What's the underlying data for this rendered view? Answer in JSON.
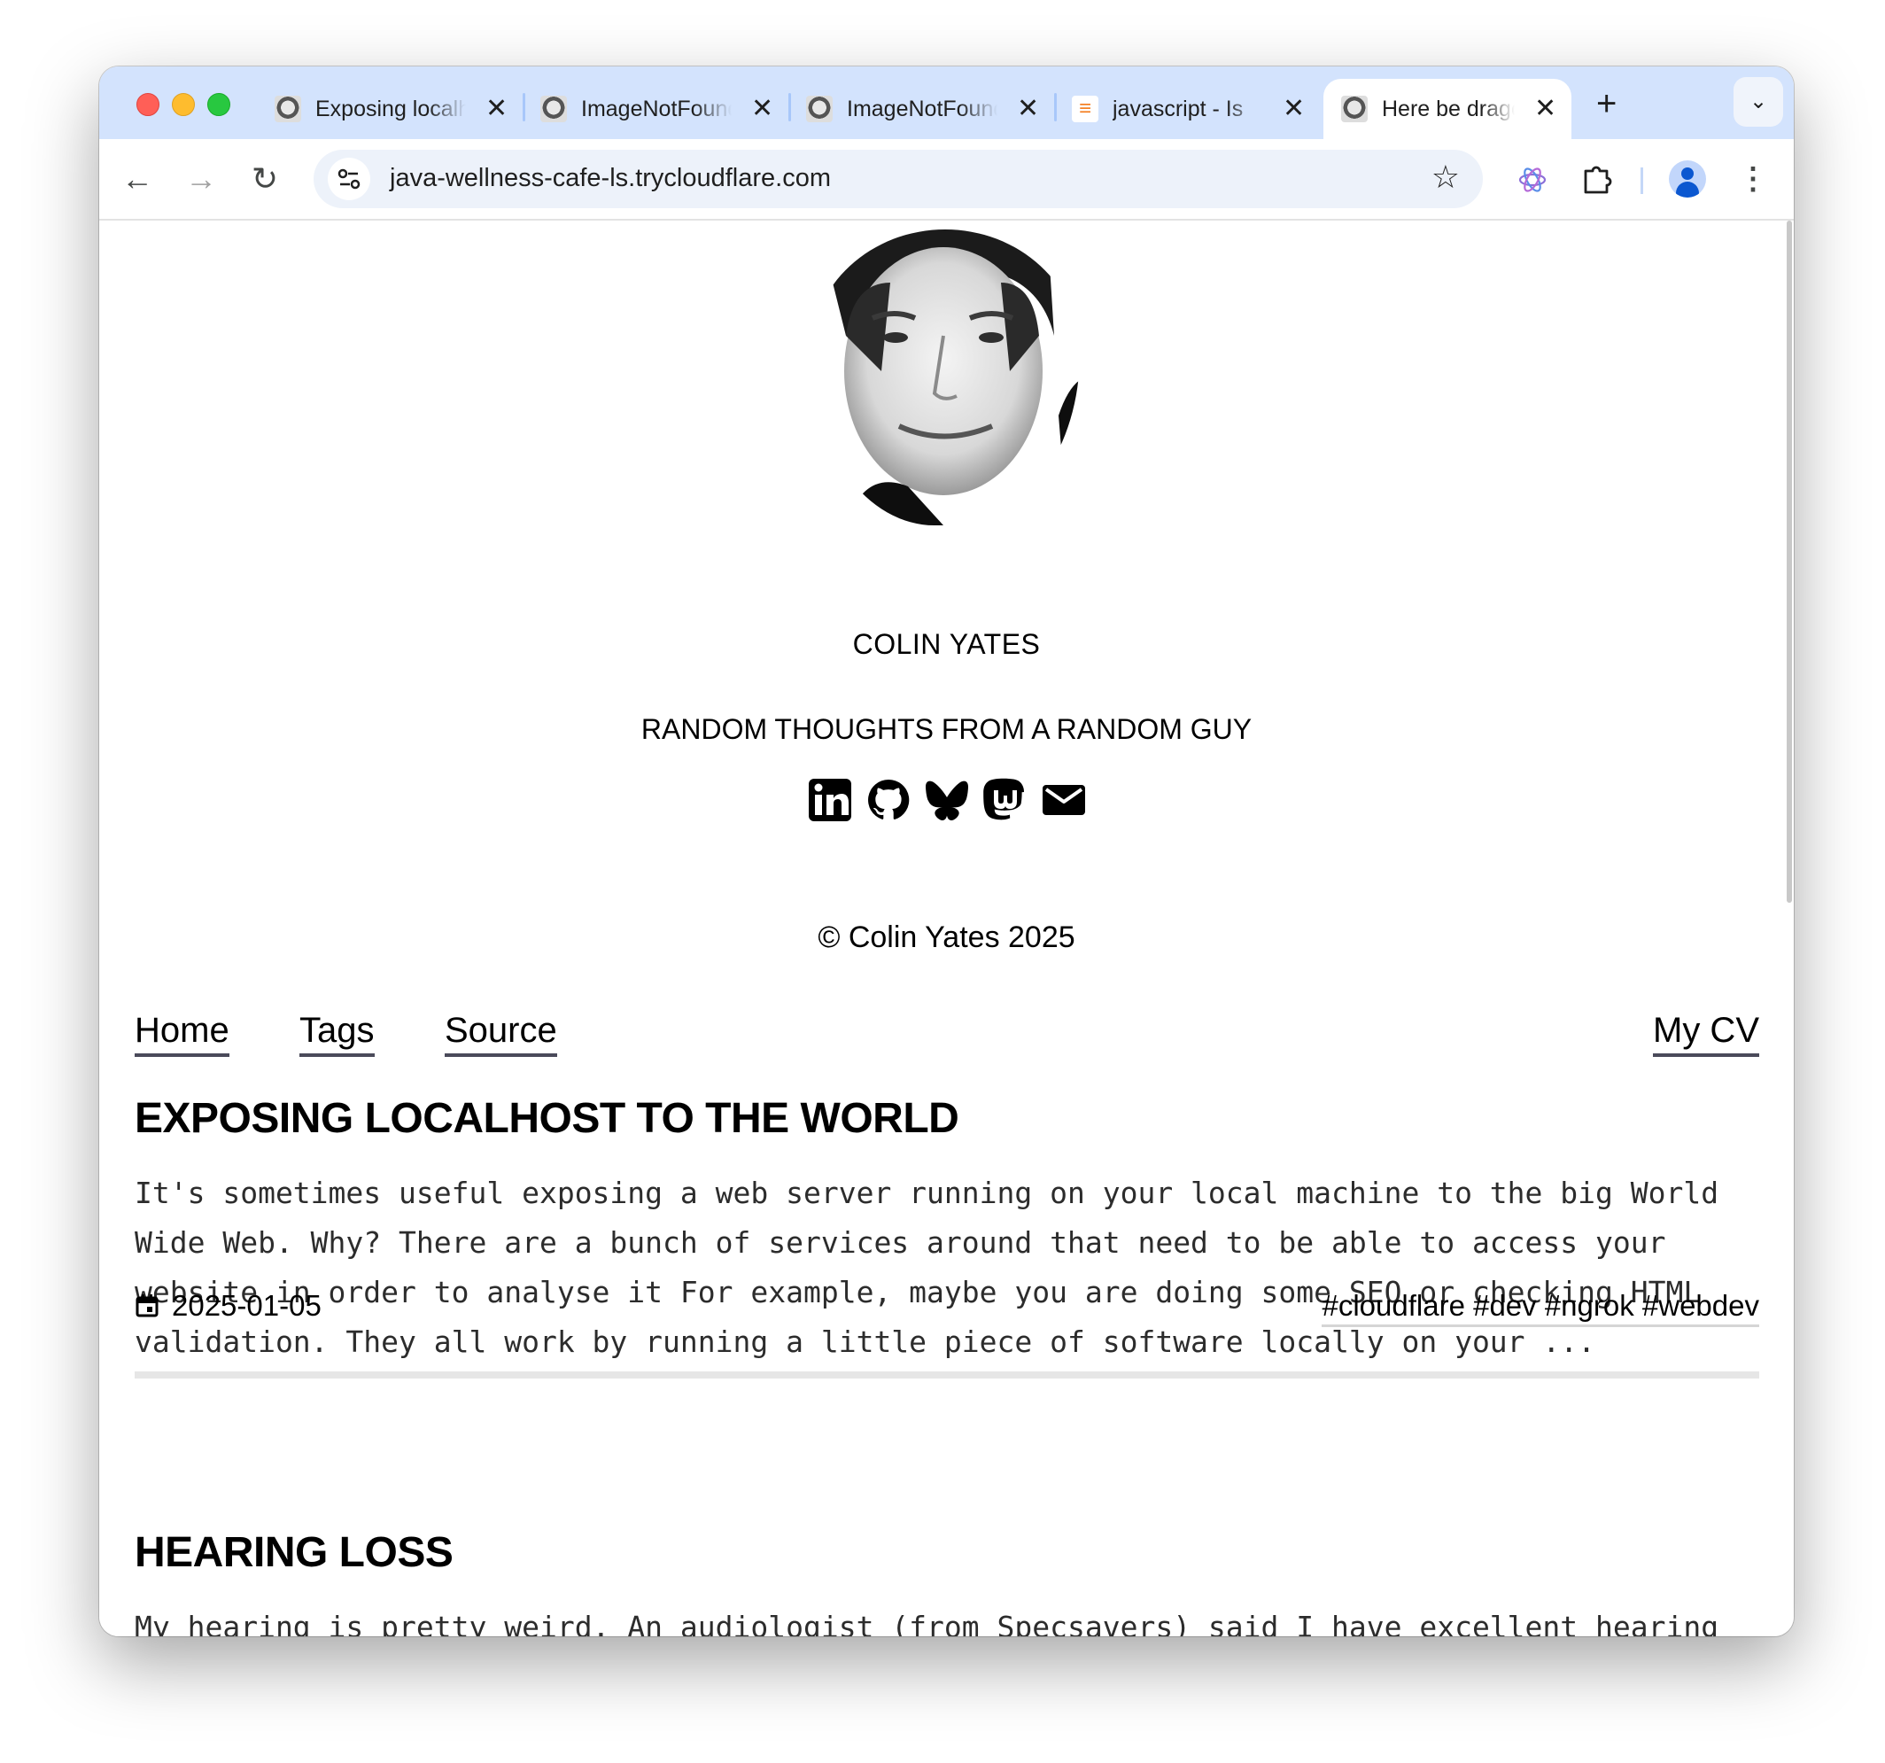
{
  "browser": {
    "tabs": [
      {
        "title": "Exposing localhost",
        "favicon": "portrait-favicon"
      },
      {
        "title": "ImageNotFound",
        "favicon": "portrait-favicon"
      },
      {
        "title": "ImageNotFound",
        "favicon": "portrait-favicon"
      },
      {
        "title": "javascript - Is",
        "favicon": "stackoverflow-favicon"
      },
      {
        "title": "Here be dragons",
        "favicon": "portrait-favicon",
        "active": true
      }
    ],
    "url": "java-wellness-cafe-ls.trycloudflare.com",
    "accent": "#d3e3fd"
  },
  "header": {
    "name": "COLIN YATES",
    "tagline": "RANDOM THOUGHTS FROM A RANDOM GUY",
    "socials": [
      "linkedin-icon",
      "github-icon",
      "bluesky-icon",
      "mastodon-icon",
      "email-icon"
    ],
    "copyright": "© Colin Yates 2025"
  },
  "nav": {
    "home": "Home",
    "tags": "Tags",
    "source": "Source",
    "cv": "My CV"
  },
  "posts": [
    {
      "title": "EXPOSING LOCALHOST TO THE WORLD",
      "excerpt": "It's sometimes useful exposing a web server running on your local machine to the big World\nWide Web. Why? There are a bunch of services around that need to be able to access your\nwebsite in order to analyse it For example, maybe you are doing some SEO or checking HTML\nvalidation. They all work by running a little piece of software locally on your ...",
      "date": "2025-01-05",
      "tags": "#cloudflare #dev #ngrok #webdev"
    },
    {
      "title": "HEARING LOSS",
      "excerpt": "My hearing is pretty weird. An audiologist (from Specsavers) said I have excellent hearing up\nto a certain frequency and then it stops at the edge. No gentle gradual decrease, just"
    }
  ]
}
